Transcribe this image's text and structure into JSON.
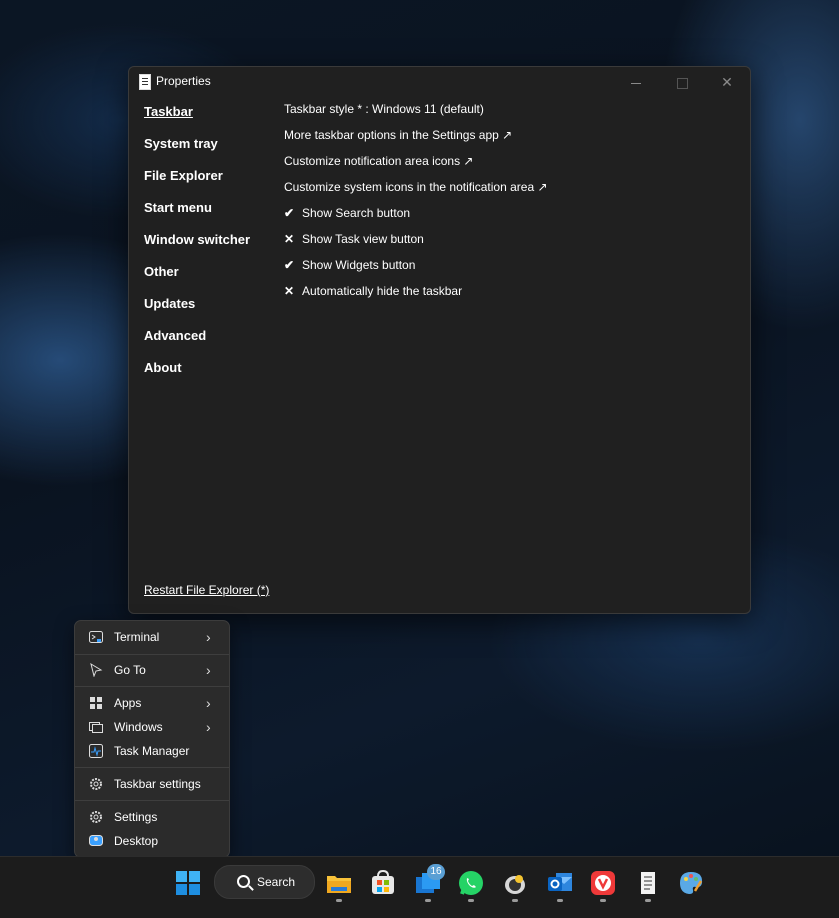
{
  "window": {
    "title": "Properties",
    "nav": [
      {
        "label": "Taskbar",
        "active": true
      },
      {
        "label": "System tray"
      },
      {
        "label": "File Explorer"
      },
      {
        "label": "Start menu"
      },
      {
        "label": "Window switcher"
      },
      {
        "label": "Other"
      },
      {
        "label": "Updates"
      },
      {
        "label": "Advanced"
      },
      {
        "label": "About"
      }
    ],
    "options": [
      {
        "mark": "",
        "label": "Taskbar style * : Windows 11 (default)"
      },
      {
        "mark": "",
        "label": "More taskbar options in the Settings app ↗"
      },
      {
        "mark": "",
        "label": "Customize notification area icons ↗"
      },
      {
        "mark": "",
        "label": "Customize system icons in the notification area ↗"
      },
      {
        "mark": "✔",
        "label": "Show Search button"
      },
      {
        "mark": "✕",
        "label": "Show Task view button"
      },
      {
        "mark": "✔",
        "label": "Show Widgets button"
      },
      {
        "mark": "✕",
        "label": "Automatically hide the taskbar"
      }
    ],
    "restart_label": "Restart File Explorer (*)"
  },
  "context_menu": {
    "items": [
      {
        "label": "Terminal",
        "icon": "terminal-icon",
        "submenu": true
      },
      {
        "label": "Go To",
        "icon": "cursor-icon",
        "submenu": true
      },
      {
        "label": "Apps",
        "icon": "apps-icon",
        "submenu": true
      },
      {
        "label": "Windows",
        "icon": "windows-icon",
        "submenu": true
      },
      {
        "label": "Task Manager",
        "icon": "task-manager-icon",
        "submenu": false
      },
      {
        "label": "Taskbar settings",
        "icon": "gear-icon",
        "submenu": false
      },
      {
        "label": "Settings",
        "icon": "gear-icon",
        "submenu": false
      },
      {
        "label": "Desktop",
        "icon": "desktop-icon",
        "submenu": false
      }
    ],
    "submenu_arrow": "›"
  },
  "taskbar": {
    "search_label": "Search",
    "badge_count": "16",
    "apps": [
      "start-icon",
      "search",
      "file-explorer-icon",
      "store-icon",
      "mail-app-icon",
      "whatsapp-icon",
      "bee-app-icon",
      "outlook-icon",
      "vivaldi-icon",
      "notepad-icon",
      "paint-icon"
    ]
  },
  "colors": {
    "window_bg": "#202020",
    "menu_bg": "#2b2b2b",
    "taskbar_bg": "#1c1c1c",
    "accent": "#0078d4"
  }
}
